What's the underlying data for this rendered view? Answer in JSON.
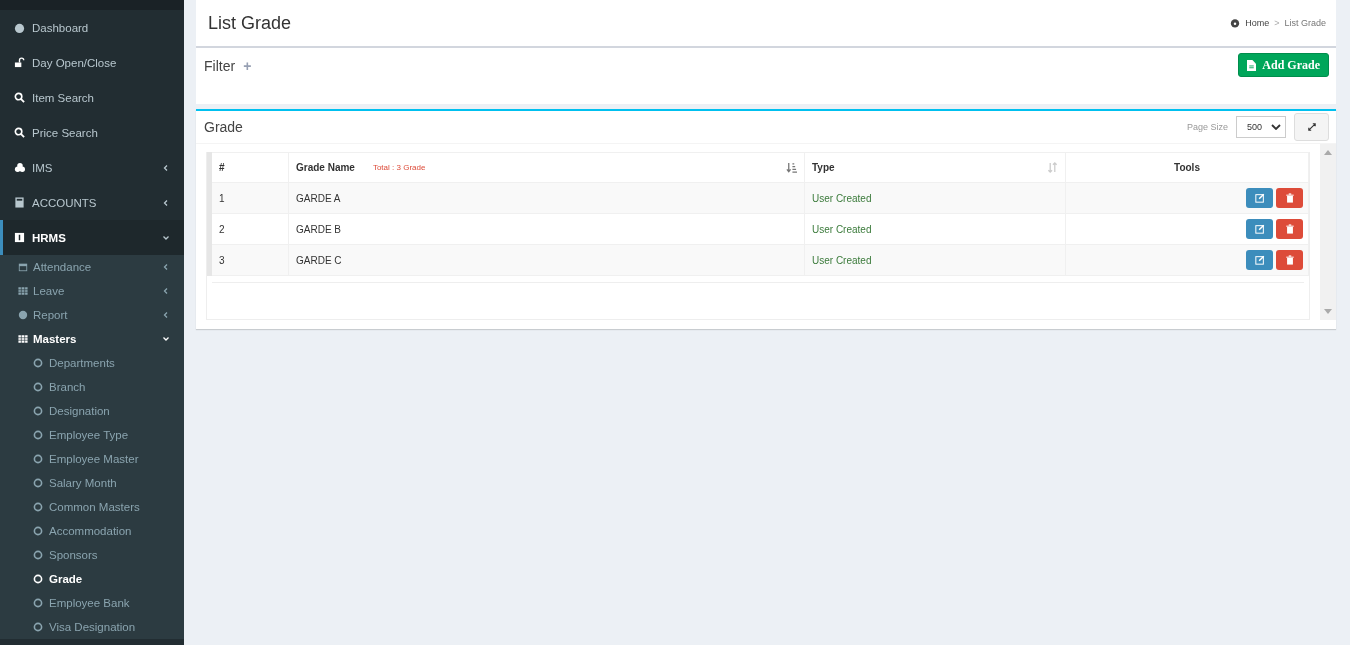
{
  "sidebar": {
    "items": [
      {
        "label": "Dashboard",
        "kind": "link",
        "selected": false
      },
      {
        "label": "Day Open/Close",
        "kind": "link",
        "selected": false
      },
      {
        "label": "Item Search",
        "kind": "link",
        "selected": false
      },
      {
        "label": "Price Search",
        "kind": "link",
        "selected": false
      },
      {
        "label": "IMS",
        "kind": "menu",
        "selected": false,
        "expanded": false
      },
      {
        "label": "ACCOUNTS",
        "kind": "menu",
        "selected": false,
        "expanded": false
      },
      {
        "label": "HRMS",
        "kind": "menu",
        "selected": true,
        "expanded": true,
        "children": [
          {
            "label": "Attendance",
            "expanded": false
          },
          {
            "label": "Leave",
            "expanded": false
          },
          {
            "label": "Report",
            "expanded": false
          },
          {
            "label": "Masters",
            "expanded": true,
            "children": [
              {
                "label": "Departments",
                "selected": false
              },
              {
                "label": "Branch",
                "selected": false
              },
              {
                "label": "Designation",
                "selected": false
              },
              {
                "label": "Employee Type",
                "selected": false
              },
              {
                "label": "Employee Master",
                "selected": false
              },
              {
                "label": "Salary Month",
                "selected": false
              },
              {
                "label": "Common Masters",
                "selected": false
              },
              {
                "label": "Accommodation",
                "selected": false
              },
              {
                "label": "Sponsors",
                "selected": false
              },
              {
                "label": "Grade",
                "selected": true
              },
              {
                "label": "Employee Bank",
                "selected": false
              },
              {
                "label": "Visa Designation",
                "selected": false
              }
            ]
          }
        ]
      }
    ]
  },
  "header": {
    "title": "List Grade",
    "breadcrumb": [
      "Home",
      "List Grade"
    ],
    "separator": ">"
  },
  "filter": {
    "title": "Filter",
    "expand_symbol": "+",
    "add_button": "Add Grade"
  },
  "grade_box": {
    "title": "Grade",
    "page_size_label": "Page Size",
    "page_size": "500"
  },
  "table": {
    "columns": [
      "#",
      "Grade Name",
      "Type",
      "Tools"
    ],
    "total": "Total : 3 Grade",
    "rows": [
      {
        "number": "1",
        "name": "GARDE A",
        "type": "User Created"
      },
      {
        "number": "2",
        "name": "GARDE B",
        "type": "User Created"
      },
      {
        "number": "3",
        "name": "GARDE C",
        "type": "User Created"
      }
    ]
  }
}
